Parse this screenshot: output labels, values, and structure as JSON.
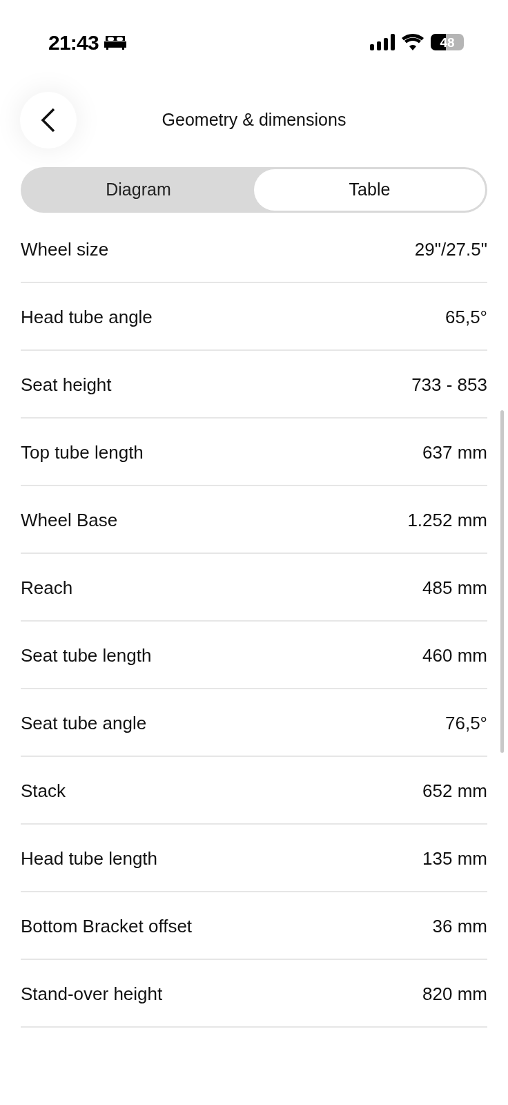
{
  "status_bar": {
    "time": "21:43",
    "battery": "48"
  },
  "header": {
    "title": "Geometry & dimensions"
  },
  "tabs": [
    {
      "label": "Diagram",
      "selected": false
    },
    {
      "label": "Table",
      "selected": true
    }
  ],
  "table": {
    "rows": [
      {
        "label": "Wheel size",
        "value": "29\"/27.5\""
      },
      {
        "label": "Head tube angle",
        "value": "65,5°"
      },
      {
        "label": "Seat height",
        "value": "733 - 853"
      },
      {
        "label": "Top tube length",
        "value": "637 mm"
      },
      {
        "label": "Wheel Base",
        "value": "1.252 mm"
      },
      {
        "label": "Reach",
        "value": "485 mm"
      },
      {
        "label": "Seat tube length",
        "value": "460 mm"
      },
      {
        "label": "Seat tube angle",
        "value": "76,5°"
      },
      {
        "label": "Stack",
        "value": "652 mm"
      },
      {
        "label": "Head tube length",
        "value": "135 mm"
      },
      {
        "label": "Bottom Bracket offset",
        "value": "36 mm"
      },
      {
        "label": "Stand-over height",
        "value": "820 mm"
      }
    ]
  }
}
